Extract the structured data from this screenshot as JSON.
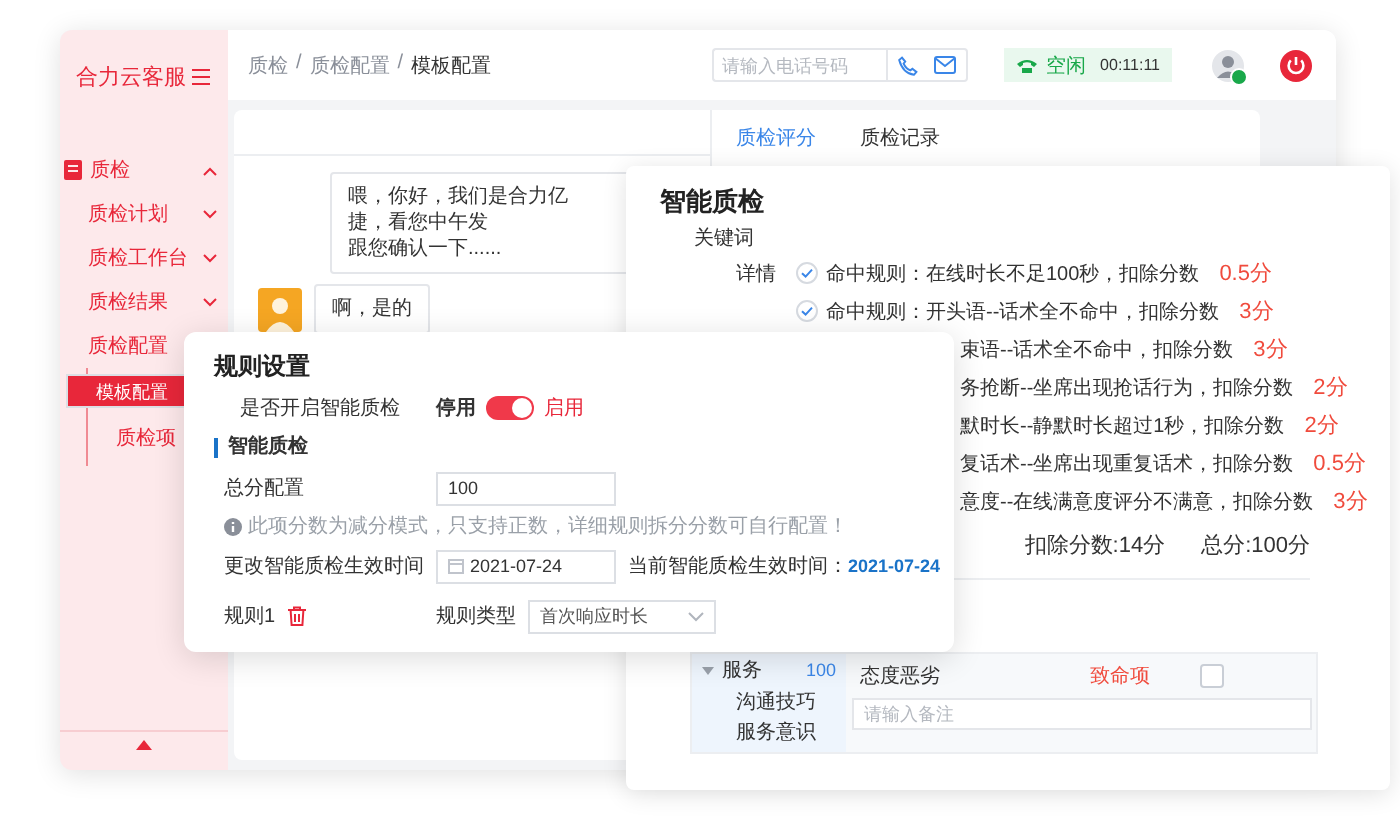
{
  "sidebar": {
    "logo": "合力云客服",
    "items": [
      {
        "label": "质检",
        "expanded": true,
        "children": [
          {
            "label": "质检计划",
            "expanded": false
          },
          {
            "label": "质检工作台",
            "expanded": false
          },
          {
            "label": "质检结果",
            "expanded": false
          },
          {
            "label": "质检配置",
            "children": [
              {
                "label": "模板配置",
                "selected": true
              },
              {
                "label": "质检项",
                "selected": false
              }
            ]
          }
        ]
      }
    ]
  },
  "header": {
    "breadcrumb": [
      "质检",
      "质检配置",
      "模板配置"
    ],
    "separator": "/",
    "phone_search": {
      "placeholder": "请输入电话号码"
    },
    "status": {
      "label": "空闲",
      "timer": "00:11:11"
    },
    "agent": {
      "online": true
    }
  },
  "chat": {
    "tabs": [
      {
        "label": "质检评分",
        "selected": true
      },
      {
        "label": "质检记录",
        "selected": false
      }
    ],
    "messages": [
      {
        "kind": "plain",
        "lines": [
          "喂，你好，我们是合力亿捷，看您中午发",
          "跟您确认一下......"
        ]
      },
      {
        "kind": "avatar",
        "lines": [
          "啊，是的"
        ]
      }
    ]
  },
  "quality_panel": {
    "title": "智能质检",
    "keyword_label": "关键词",
    "detail_label": "详情",
    "rules": [
      {
        "kind": "full",
        "checked": true,
        "text": "命中规则：在线时长不足100秒，扣除分数",
        "score": "0.5分"
      },
      {
        "kind": "full",
        "checked": true,
        "text": "命中规则：开头语--话术全不命中，扣除分数",
        "score": "3分"
      },
      {
        "kind": "covered",
        "text": "束语--话术全不命中，扣除分数",
        "score": "3分"
      },
      {
        "kind": "covered",
        "text": "务抢断--坐席出现抢话行为，扣除分数",
        "score": "2分"
      },
      {
        "kind": "covered",
        "text": "默时长--静默时长超过1秒，扣除分数",
        "score": "2分"
      },
      {
        "kind": "covered",
        "text": "复话术--坐席出现重复话术，扣除分数",
        "score": "0.5分"
      },
      {
        "kind": "covered",
        "text": "意度--在线满意度评分不满意，扣除分数",
        "score": "3分"
      }
    ],
    "deducted": "扣除分数:14分",
    "total": "总分:100分",
    "tree": {
      "label": "服务",
      "score": "100",
      "expanded": true,
      "children": [
        "沟通技巧",
        "服务意识"
      ]
    },
    "item": {
      "name": "态度恶劣",
      "severity": "致命项",
      "checked": false,
      "remark": {
        "placeholder": "请输入备注"
      }
    }
  },
  "rule_dialog": {
    "title": "规则设置",
    "enable_label": "是否开启智能质检",
    "off_label": "停用",
    "on_label": "启用",
    "enabled": true,
    "section": "智能质检",
    "total_label": "总分配置",
    "total_value": "100",
    "hint": "此项分数为减分模式，只支持正数，详细规则拆分分数可自行配置！",
    "date_label": "更改智能质检生效时间",
    "date_value": "2021-07-24",
    "current_label": "当前智能质检生效时间：",
    "current_value": "2021-07-24",
    "rule_label": "规则1",
    "rule_type_label": "规则类型",
    "rule_type_value": "首次响应时长"
  }
}
